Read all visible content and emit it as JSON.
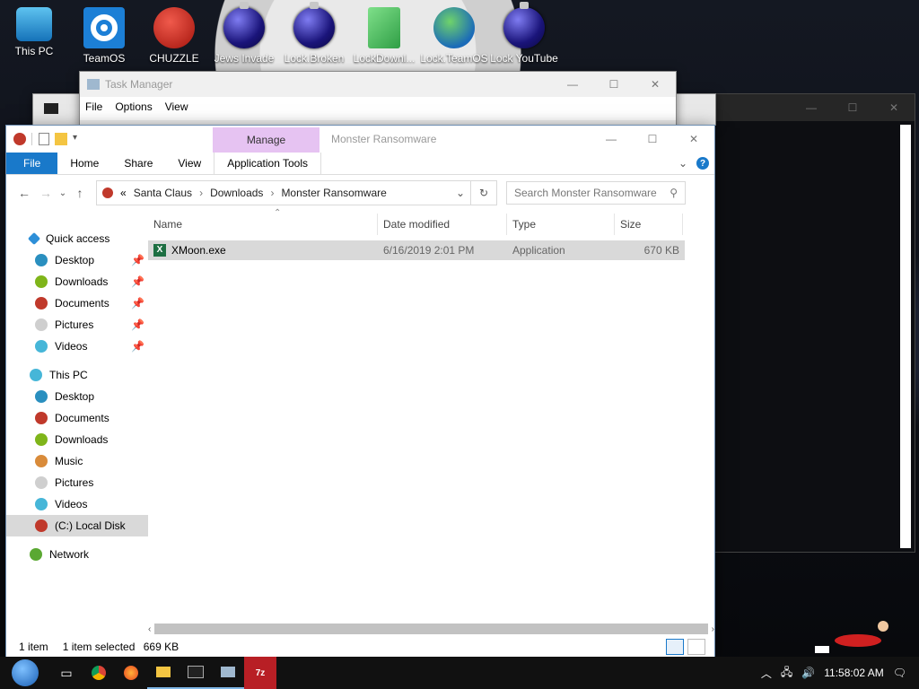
{
  "desktop": {
    "icons": [
      {
        "label": "This PC",
        "icon": "monitor-icon"
      },
      {
        "label": "TeamOS",
        "icon": "gear-icon"
      },
      {
        "label": "CHUZZLE",
        "icon": "chuzzle-icon"
      },
      {
        "label": "Jews Invade",
        "icon": "orb-icon"
      },
      {
        "label": "Lock.Broken",
        "icon": "orb-icon"
      },
      {
        "label": "LockDownl...",
        "icon": "notepad-icon"
      },
      {
        "label": "Lock.TeamOS",
        "icon": "globe-icon"
      },
      {
        "label": "Lock YouTube",
        "icon": "orb-icon"
      }
    ]
  },
  "task_manager": {
    "title": "Task Manager",
    "menu": [
      "File",
      "Options",
      "View"
    ]
  },
  "explorer": {
    "manage_tab": "Manage",
    "title": "Monster Ransomware",
    "ribbon_tabs": [
      "File",
      "Home",
      "Share",
      "View",
      "Application Tools"
    ],
    "address": {
      "prefix": "«",
      "segments": [
        "Santa Claus",
        "Downloads",
        "Monster Ransomware"
      ]
    },
    "search_placeholder": "Search Monster Ransomware",
    "columns": {
      "name": "Name",
      "date": "Date modified",
      "type": "Type",
      "size": "Size"
    },
    "files": [
      {
        "name": "XMoon.exe",
        "date": "6/16/2019 2:01 PM",
        "type": "Application",
        "size": "670 KB"
      }
    ],
    "nav": {
      "quick_access": "Quick access",
      "quick_items": [
        "Desktop",
        "Downloads",
        "Documents",
        "Pictures",
        "Videos"
      ],
      "this_pc": "This PC",
      "pc_items": [
        "Desktop",
        "Documents",
        "Downloads",
        "Music",
        "Pictures",
        "Videos",
        "(C:) Local Disk"
      ],
      "network": "Network"
    },
    "status": {
      "count": "1 item",
      "selected": "1 item selected",
      "size": "669 KB"
    }
  },
  "taskbar": {
    "time": "11:58:02 AM"
  },
  "colors": {
    "accent": "#1979ca",
    "manage": "#e6c3f2"
  }
}
